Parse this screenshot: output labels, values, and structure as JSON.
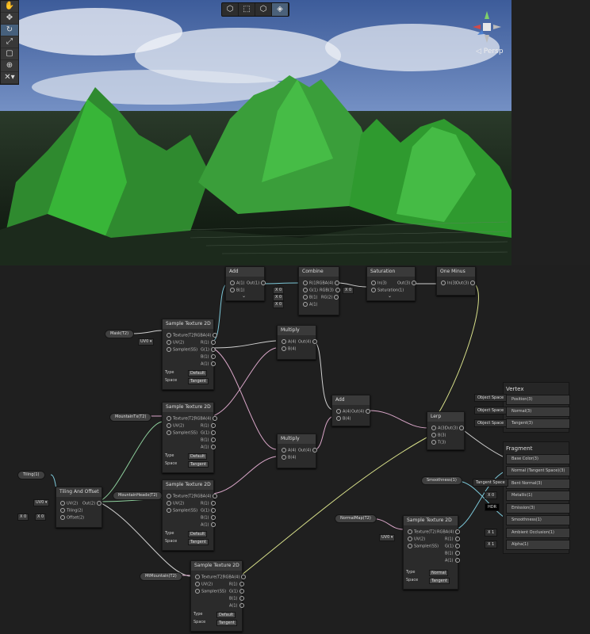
{
  "scene": {
    "toolbar": [
      "hand",
      "move",
      "rotate",
      "scale",
      "rect",
      "transform",
      "custom"
    ],
    "top_toolbar": [
      "draw-mode",
      "rect-select",
      "wireframe",
      "shaded"
    ],
    "persp_label": "◁ Persp"
  },
  "nodes": {
    "add1": {
      "title": "Add",
      "in": [
        "A(1)",
        "B(1)"
      ],
      "out": "Out(1)"
    },
    "combine": {
      "title": "Combine",
      "in": [
        "R(1)",
        "G(1)",
        "B(1)",
        "A(1)"
      ],
      "out": [
        "RGBA(4)",
        "RGB(3)",
        "RG(2)"
      ]
    },
    "saturation": {
      "title": "Saturation",
      "in": [
        "In(3)",
        "Saturation(1)"
      ],
      "out": "Out(3)"
    },
    "oneminus": {
      "title": "One Minus",
      "in": [
        "In(3)"
      ],
      "out": "Out(3)"
    },
    "multiply1": {
      "title": "Multiply",
      "in": [
        "A(4)",
        "B(4)"
      ],
      "out": "Out(4)"
    },
    "multiply2": {
      "title": "Multiply",
      "in": [
        "A(4)",
        "B(4)"
      ],
      "out": "Out(4)"
    },
    "add2": {
      "title": "Add",
      "in": [
        "A(4)",
        "B(4)"
      ],
      "out": "Out(4)"
    },
    "lerp": {
      "title": "Lerp",
      "in": [
        "A(3)",
        "B(3)",
        "T(3)"
      ],
      "out": "Out(3)"
    },
    "tiling": {
      "title": "Tiling And Offset",
      "in": [
        "UV(2)",
        "Tiling(2)",
        "Offset(2)"
      ],
      "out": "Out(2)"
    },
    "sample_in": [
      "Texture(T2)",
      "UV(2)",
      "Sampler(SS)"
    ],
    "sample_out": [
      "RGBA(4)",
      "R(1)",
      "G(1)",
      "B(1)",
      "A(1)"
    ],
    "sample_title": "Sample Texture 2D",
    "type_label": "Type",
    "space_label": "Space",
    "type_default": "Default",
    "type_normal": "Normal",
    "space_tangent": "Tangent"
  },
  "props": {
    "mask": "Mask(T2)",
    "mountain1": "MountainTx(T2)",
    "mountain2": "MountainHeadx(T2)",
    "mountain3": "MtMountain(T2)",
    "tiling": "Tiling(1)",
    "normal": "NormalMap(T2)",
    "smooth": "Smoothness(1)"
  },
  "fields": {
    "uv0": "UV0 ▾",
    "x": "X",
    "zero": "0",
    "one": "1",
    "hdr": "HDR"
  },
  "vertex": {
    "title": "Vertex",
    "space": "Object Space",
    "rows": [
      "Position(3)",
      "Normal(3)",
      "Tangent(3)"
    ]
  },
  "fragment": {
    "title": "Fragment",
    "tangent_space": "Tangent Space",
    "rows": [
      "Base Color(3)",
      "Normal (Tangent Space)(3)",
      "Bent Normal(3)",
      "Metallic(1)",
      "Emission(3)",
      "Smoothness(1)",
      "Ambient Occlusion(1)",
      "Alpha(1)"
    ]
  },
  "colors": {
    "sky": "#5d7fbf",
    "grass": "#3cc83c",
    "wire_green": "#8fd19e",
    "wire_pink": "#d9a6c8",
    "wire_blue": "#7cc7d8",
    "wire_yellow": "#d8e08a",
    "wire_white": "#cfcfcf"
  }
}
